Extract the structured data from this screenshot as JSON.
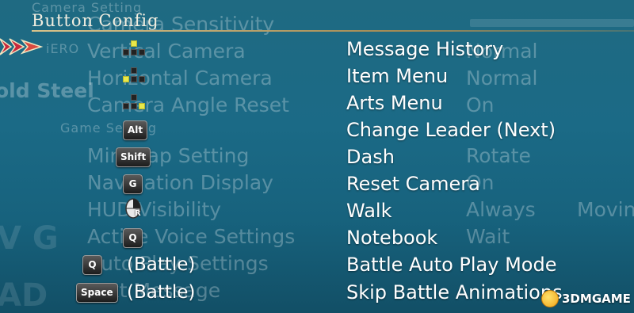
{
  "header": {
    "title_first": "Button",
    "title_second": "Config"
  },
  "background_text": {
    "camera_sensitivity": "Camera Sensitivity",
    "top_small": "Camera Setting",
    "left_partial": "iERO",
    "stellar": "old Steel",
    "game_setting": "Game Setting",
    "vertical_camera": "Vertical Camera",
    "horizontal_camera": "Horizontal Camera",
    "camera_angle_reset": "Camera Angle Reset",
    "minimap_setting": "Minimap Setting",
    "navigation_display": "Navigation Display",
    "hud_visibility": "HUD Visibility",
    "active_voice_settings": "Active Voice Settings",
    "auto_play_settings": "Auto Play Settings",
    "message": "Text Message",
    "val_normal_1": "Normal",
    "val_normal_2": "Normal",
    "val_on_1": "On",
    "val_rotate": "Rotate",
    "val_on_2": "On",
    "val_always": "Always",
    "val_moving": "Moving",
    "val_wait": "Wait",
    "big_letters": "V G",
    "bottom_left": "AD"
  },
  "bindings": [
    {
      "key_type": "dpad",
      "key_label": "",
      "battle": "",
      "action": "Message History"
    },
    {
      "key_type": "dpad",
      "key_label": "",
      "battle": "",
      "action": "Item Menu"
    },
    {
      "key_type": "dpad",
      "key_label": "",
      "battle": "",
      "action": "Arts Menu"
    },
    {
      "key_type": "key",
      "key_label": "Alt",
      "battle": "",
      "action": "Change Leader (Next)"
    },
    {
      "key_type": "key",
      "key_label": "Shift",
      "battle": "",
      "action": "Dash"
    },
    {
      "key_type": "key",
      "key_label": "G",
      "battle": "",
      "action": "Reset Camera"
    },
    {
      "key_type": "mouse",
      "key_label": "R",
      "battle": "",
      "action": "Walk"
    },
    {
      "key_type": "key",
      "key_label": "Q",
      "battle": "",
      "action": "Notebook"
    },
    {
      "key_type": "key",
      "key_label": "Q",
      "battle": "(Battle)",
      "action": "Battle Auto Play Mode"
    },
    {
      "key_type": "key",
      "key_label": "Space",
      "battle": "(Battle)",
      "action": "Skip Battle Animations"
    }
  ],
  "watermark": {
    "text": "3DMGAME"
  },
  "colors": {
    "accent_gold": "#d9c38a",
    "cursor_red": "#c8283c",
    "dpad_highlight": "#e9e94a"
  }
}
